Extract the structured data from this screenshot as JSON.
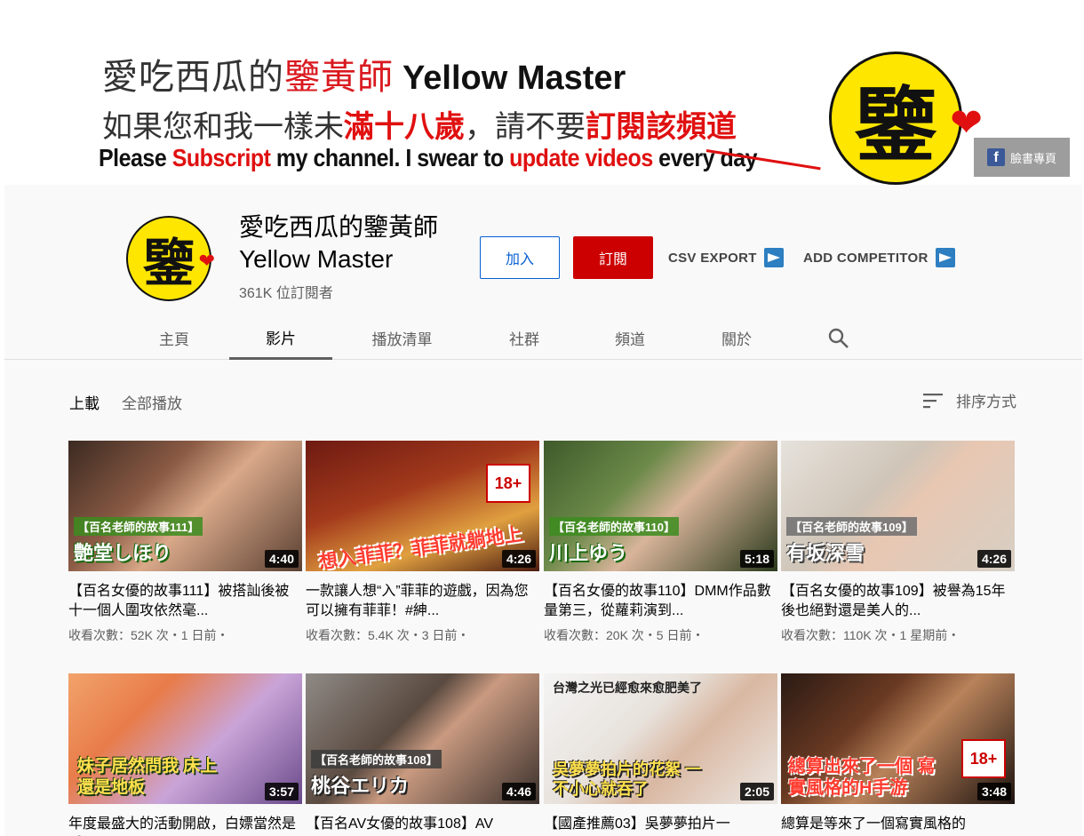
{
  "banner": {
    "line1_a": "愛吃西瓜的",
    "line1_b": "鑒黃師",
    "line1_en": "Yellow Master",
    "line2_a": "如果您和我一樣未",
    "line2_b": "滿十八歲",
    "line2_c": "，請不要",
    "line2_d": "訂閱該頻道",
    "line3_a": "Please ",
    "line3_b": "Subscript",
    "line3_c": " my channel. I swear to ",
    "line3_d": "update videos",
    "line3_e": " every day",
    "logo_char": "鑒",
    "fb_label": "臉書專頁"
  },
  "channel": {
    "name_line1": "愛吃西瓜的鑒黃師",
    "name_line2": "Yellow Master",
    "subscribers": "361K 位訂閱者",
    "avatar_char": "鑒",
    "join_label": "加入",
    "subscribe_label": "訂閱",
    "csv_export_label": "CSV EXPORT",
    "add_competitor_label": "ADD COMPETITOR"
  },
  "tabs": [
    "主頁",
    "影片",
    "播放清單",
    "社群",
    "頻道",
    "關於"
  ],
  "filters": {
    "uploads": "上載",
    "play_all": "全部播放",
    "sort": "排序方式"
  },
  "videos": [
    {
      "title": "【百名女優的故事111】被搭訕後被十一個人圍攻依然毫...",
      "meta": "收看次數：52K 次・1 日前・",
      "duration": "4:40",
      "tag": "【百名老師的故事111】",
      "name": "艶堂しほり"
    },
    {
      "title": "一款讓人想“入”菲菲的遊戲，因為您可以擁有菲菲！#紳...",
      "meta": "收看次數：5.4K 次・3 日前・",
      "duration": "4:26",
      "overlay": "想入菲菲？菲菲就躺地上",
      "badge": "18+"
    },
    {
      "title": "【百名女優的故事110】DMM作品數量第三，從蘿莉演到...",
      "meta": "收看次數：20K 次・5 日前・",
      "duration": "5:18",
      "tag": "【百名老師的故事110】",
      "name": "川上ゆう"
    },
    {
      "title": "【百名女優的故事109】被譽為15年後也絕對還是美人的...",
      "meta": "收看次數：110K 次・1 星期前・",
      "duration": "4:26",
      "tag": "【百名老師的故事109】",
      "name": "有坂深雪"
    },
    {
      "title": "年度最盛大的活動開啟，白嫖當然是愛…",
      "meta": "",
      "duration": "3:57",
      "overlay": "妹子居然問我 床上還是地板"
    },
    {
      "title": "【百名AV女優的故事108】AV",
      "meta": "",
      "duration": "4:46",
      "tag": "【百名老師的故事108】",
      "name": "桃谷エリカ"
    },
    {
      "title": "【國產推薦03】吳夢夢拍片一",
      "meta": "",
      "duration": "2:05",
      "overlay_top": "台灣之光已經愈來愈肥美了",
      "overlay": "吳夢夢拍片的花絮 一不小心就吞了"
    },
    {
      "title": "總算是等來了一個寫實風格的",
      "meta": "",
      "duration": "3:48",
      "overlay": "總算出來了一個 寫實風格的H手游",
      "badge": "18+"
    }
  ],
  "colors": {
    "subscribe": "#cc0000",
    "join_border": "#065fd4",
    "logo_yellow": "#ffe600",
    "banner_red": "#e01010"
  }
}
